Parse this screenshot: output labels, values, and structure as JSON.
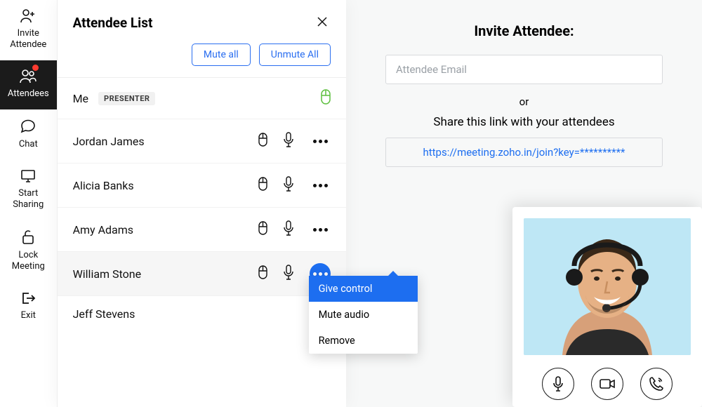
{
  "sidebar": {
    "items": [
      {
        "label": "Invite Attendee"
      },
      {
        "label": "Attendees"
      },
      {
        "label": "Chat"
      },
      {
        "label": "Start Sharing"
      },
      {
        "label": "Lock Meeting"
      },
      {
        "label": "Exit"
      }
    ]
  },
  "panel": {
    "title": "Attendee List",
    "mute_all": "Mute all",
    "unmute_all": "Unmute All",
    "presenter_badge": "PRESENTER"
  },
  "attendees": [
    {
      "name": "Me"
    },
    {
      "name": "Jordan James"
    },
    {
      "name": "Alicia Banks"
    },
    {
      "name": "Amy Adams"
    },
    {
      "name": "William Stone"
    },
    {
      "name": "Jeff Stevens"
    }
  ],
  "menu": {
    "give_control": "Give control",
    "mute_audio": "Mute audio",
    "remove": "Remove"
  },
  "invite": {
    "title": "Invite Attendee:",
    "email_placeholder": "Attendee Email",
    "or": "or",
    "share_label": "Share this link with your attendees",
    "link": "https://meeting.zoho.in/join?key=**********"
  }
}
